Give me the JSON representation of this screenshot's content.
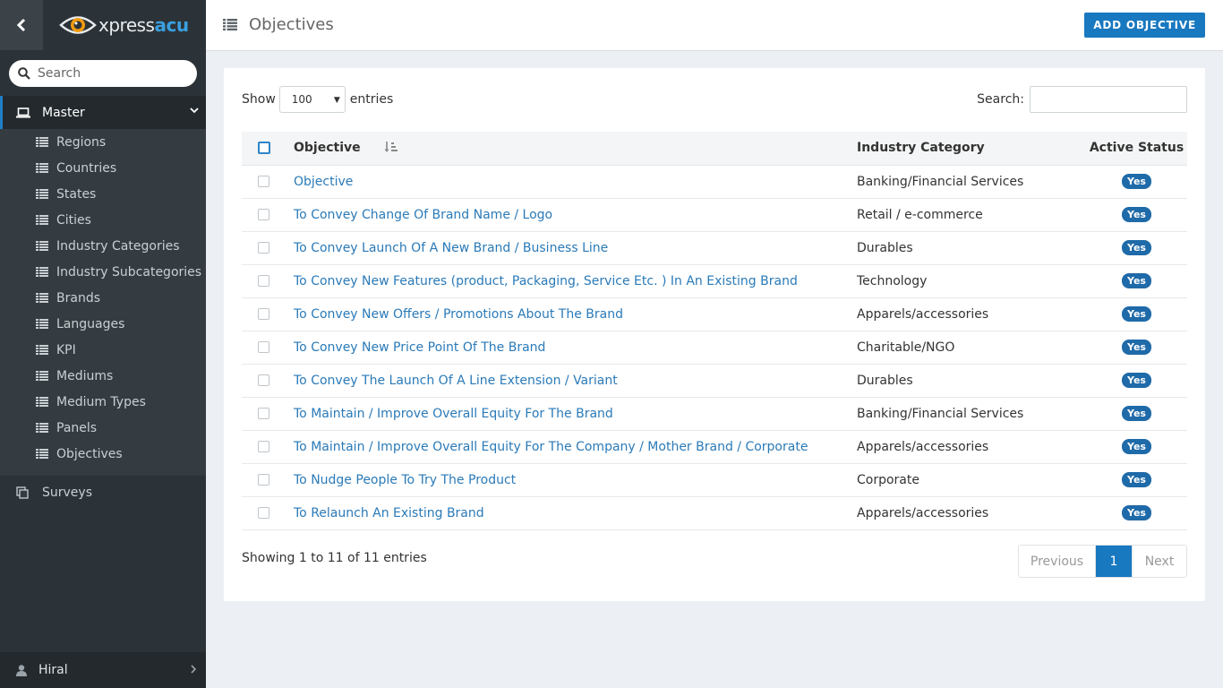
{
  "brand": {
    "name_part1": "xpress",
    "name_part2": "acu"
  },
  "sidebar": {
    "search_placeholder": "Search",
    "master_label": "Master",
    "items": [
      {
        "label": "Regions"
      },
      {
        "label": "Countries"
      },
      {
        "label": "States"
      },
      {
        "label": "Cities"
      },
      {
        "label": "Industry Categories"
      },
      {
        "label": "Industry Subcategories"
      },
      {
        "label": "Brands"
      },
      {
        "label": "Languages"
      },
      {
        "label": "KPI"
      },
      {
        "label": "Mediums"
      },
      {
        "label": "Medium Types"
      },
      {
        "label": "Panels"
      },
      {
        "label": "Objectives"
      }
    ],
    "surveys_label": "Surveys",
    "user_name": "Hiral"
  },
  "header": {
    "title": "Objectives",
    "add_button": "ADD OBJECTIVE"
  },
  "table_controls": {
    "show_label": "Show",
    "entries_value": "100",
    "entries_label": "entries",
    "search_label": "Search:"
  },
  "table": {
    "columns": [
      "Objective",
      "Industry Category",
      "Active Status"
    ],
    "rows": [
      {
        "objective": "Objective",
        "category": "Banking/Financial Services",
        "status": "Yes"
      },
      {
        "objective": "To Convey Change Of Brand Name / Logo",
        "category": "Retail / e-commerce",
        "status": "Yes"
      },
      {
        "objective": "To Convey Launch Of A New Brand / Business Line",
        "category": "Durables",
        "status": "Yes"
      },
      {
        "objective": "To Convey New Features (product, Packaging, Service Etc. ) In An Existing Brand",
        "category": "Technology",
        "status": "Yes"
      },
      {
        "objective": "To Convey New Offers / Promotions About The Brand",
        "category": "Apparels/accessories",
        "status": "Yes"
      },
      {
        "objective": "To Convey New Price Point Of The Brand",
        "category": "Charitable/NGO",
        "status": "Yes"
      },
      {
        "objective": "To Convey The Launch Of A Line Extension / Variant",
        "category": "Durables",
        "status": "Yes"
      },
      {
        "objective": "To Maintain / Improve Overall Equity For The Brand",
        "category": "Banking/Financial Services",
        "status": "Yes"
      },
      {
        "objective": "To Maintain / Improve Overall Equity For The Company / Mother Brand / Corporate",
        "category": "Apparels/accessories",
        "status": "Yes"
      },
      {
        "objective": "To Nudge People To Try The Product",
        "category": "Corporate",
        "status": "Yes"
      },
      {
        "objective": "To Relaunch An Existing Brand",
        "category": "Apparels/accessories",
        "status": "Yes"
      }
    ]
  },
  "footer": {
    "info": "Showing 1 to 11 of 11 entries",
    "prev": "Previous",
    "current_page": "1",
    "next": "Next"
  },
  "colors": {
    "accent": "#1878c0",
    "sidebar_bg": "#2c3338",
    "badge": "#1f6aa8",
    "link": "#2a7ab8"
  },
  "icons": [
    "chevron-left-icon",
    "eye-logo-icon",
    "search-icon",
    "laptop-icon",
    "chevron-down-icon",
    "list-icon",
    "copy-icon",
    "user-icon",
    "chevron-right-icon",
    "sort-icon"
  ]
}
